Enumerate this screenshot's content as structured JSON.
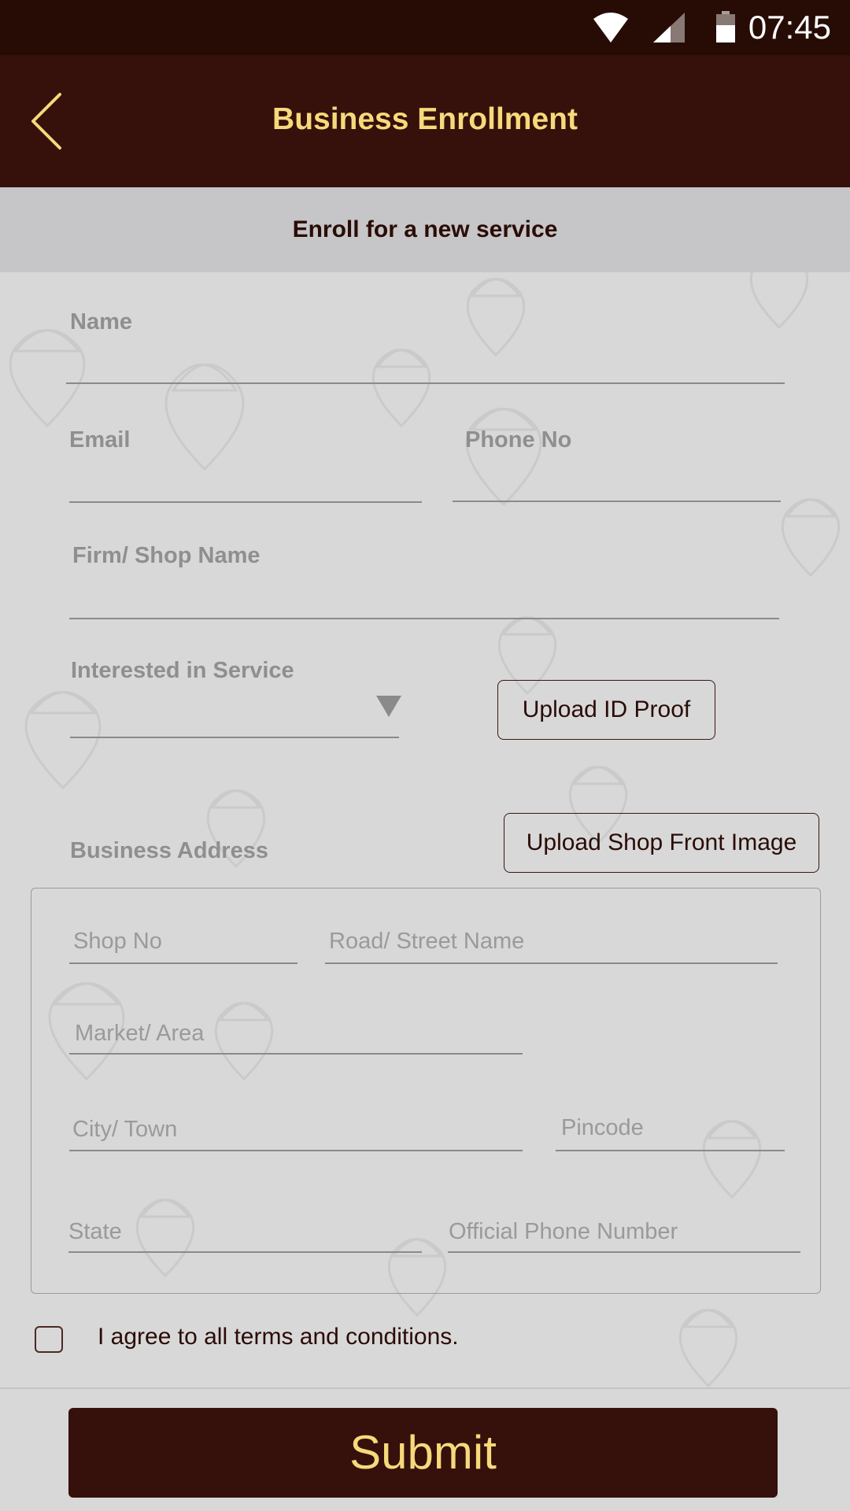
{
  "status_bar": {
    "time": "07:45",
    "icons": [
      "wifi-icon",
      "signal-icon",
      "battery-icon"
    ]
  },
  "app_bar": {
    "title": "Business Enrollment",
    "back_icon": "chevron-left-icon"
  },
  "subheader": {
    "text": "Enroll for a new service"
  },
  "form": {
    "name_label": "Name",
    "email_label": "Email",
    "phone_label": "Phone No",
    "firm_label": "Firm/ Shop Name",
    "service_label": "Interested in Service",
    "service_selected": "",
    "upload_id_label": "Upload ID Proof",
    "upload_shop_label": "Upload Shop Front Image",
    "business_address_label": "Business Address",
    "address": {
      "shop_no_placeholder": "Shop No",
      "road_placeholder": "Road/ Street Name",
      "market_placeholder": "Market/ Area",
      "city_placeholder": "City/ Town",
      "pincode_placeholder": "Pincode",
      "state_placeholder": "State",
      "official_phone_placeholder": "Official Phone Number"
    },
    "terms_label": "I agree to all terms and conditions.",
    "terms_checked": false,
    "submit_label": "Submit"
  },
  "colors": {
    "primary": "#36100a",
    "accent": "#f6d97b",
    "background": "#d8d8d8"
  }
}
